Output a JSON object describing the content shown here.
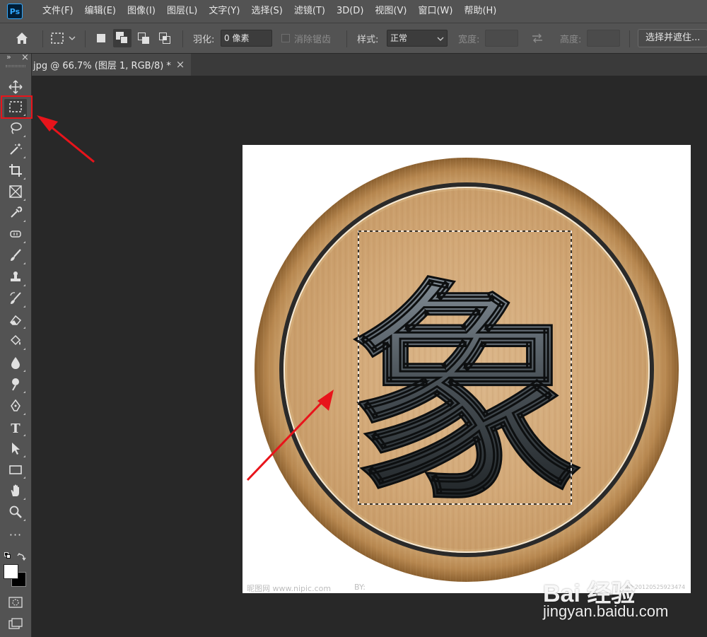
{
  "app": {
    "logo": "Ps"
  },
  "menu": [
    "文件(F)",
    "编辑(E)",
    "图像(I)",
    "图层(L)",
    "文字(Y)",
    "选择(S)",
    "滤镜(T)",
    "3D(D)",
    "视图(V)",
    "窗口(W)",
    "帮助(H)"
  ],
  "options": {
    "feather_label": "羽化:",
    "feather_value": "0 像素",
    "antialias_label": "消除锯齿",
    "style_label": "样式:",
    "style_value": "正常",
    "width_label": "宽度:",
    "height_label": "高度:",
    "select_mask_button": "选择并遮住..."
  },
  "document_tab": {
    "title": "jpg @ 66.7% (图层 1, RGB/8) *",
    "close_glyph": "×"
  },
  "toolbox": {
    "header_collapse": "»",
    "header_close": "×",
    "tools": [
      {
        "name": "move-tool",
        "icon": "move-icon"
      },
      {
        "name": "rectangular-marquee-tool",
        "icon": "marquee-icon",
        "selected": true
      },
      {
        "name": "lasso-tool",
        "icon": "lasso-icon"
      },
      {
        "name": "magic-wand-tool",
        "icon": "magic-wand-icon"
      },
      {
        "name": "crop-tool",
        "icon": "crop-icon"
      },
      {
        "name": "frame-tool",
        "icon": "frame-icon"
      },
      {
        "name": "eyedropper-tool",
        "icon": "eyedropper-icon"
      },
      {
        "name": "spot-healing-tool",
        "icon": "healing-icon"
      },
      {
        "name": "brush-tool",
        "icon": "brush-icon"
      },
      {
        "name": "clone-stamp-tool",
        "icon": "stamp-icon"
      },
      {
        "name": "history-brush-tool",
        "icon": "history-brush-icon"
      },
      {
        "name": "eraser-tool",
        "icon": "eraser-icon"
      },
      {
        "name": "paint-bucket-tool",
        "icon": "paint-bucket-icon"
      },
      {
        "name": "blur-tool",
        "icon": "blur-icon"
      },
      {
        "name": "dodge-tool",
        "icon": "dodge-icon"
      },
      {
        "name": "pen-tool",
        "icon": "pen-icon"
      },
      {
        "name": "type-tool",
        "icon": "type-icon"
      },
      {
        "name": "path-selection-tool",
        "icon": "path-select-icon"
      },
      {
        "name": "rectangle-tool",
        "icon": "rectangle-icon"
      },
      {
        "name": "hand-tool",
        "icon": "hand-icon"
      },
      {
        "name": "zoom-tool",
        "icon": "zoom-icon"
      },
      {
        "name": "edit-toolbar",
        "icon": "more-icon",
        "label": "···"
      }
    ],
    "type_glyph": "T"
  },
  "canvas": {
    "character": "象",
    "watermark_left": "昵图网 www.nipic.com",
    "watermark_by": "BY: ",
    "watermark_right": "NO:20120525923474"
  },
  "baidu": {
    "logo_text": "Bai  经验",
    "url": "jingyan.baidu.com"
  },
  "colors": {
    "annotation": "#e8141b",
    "ui_panel": "#535353",
    "workspace": "#282828"
  }
}
